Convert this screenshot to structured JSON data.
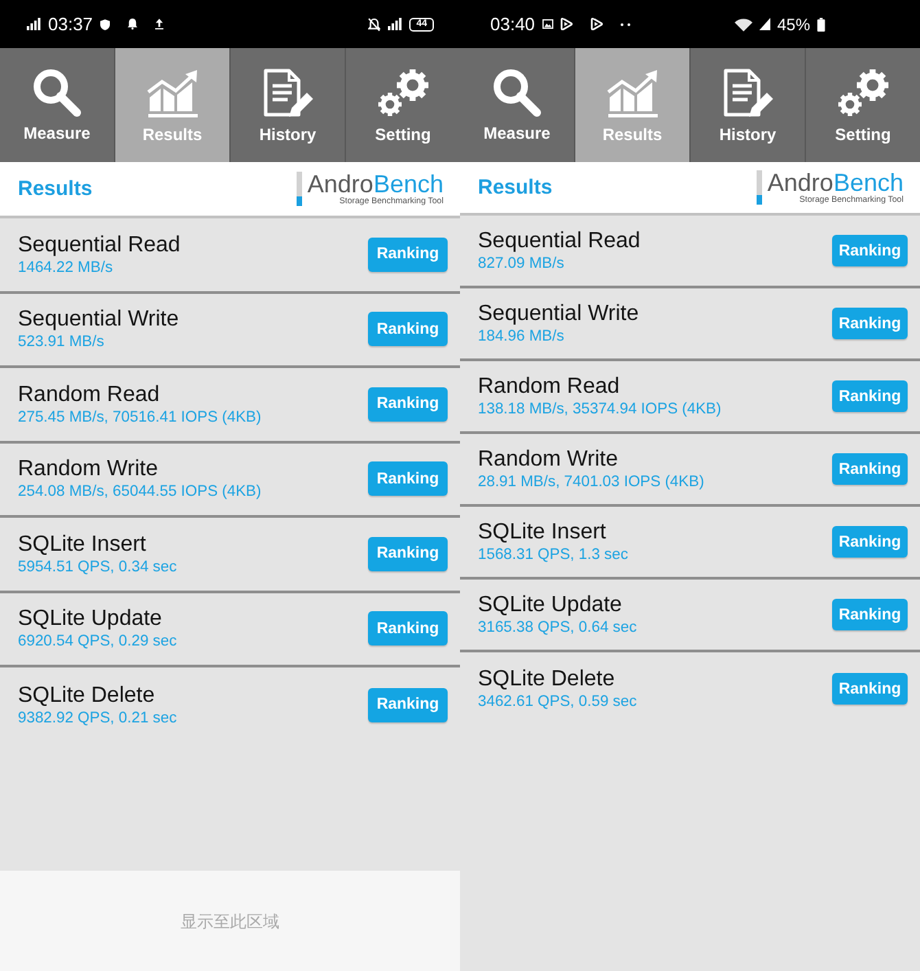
{
  "screens": [
    {
      "status_bar": {
        "time": "03:37",
        "battery": {
          "kind": "inside",
          "text": "44"
        }
      },
      "tabs": [
        {
          "label": "Measure",
          "selected": false
        },
        {
          "label": "Results",
          "selected": true
        },
        {
          "label": "History",
          "selected": false
        },
        {
          "label": "Setting",
          "selected": false
        }
      ],
      "header": {
        "title": "Results",
        "logo": {
          "wordmark": [
            "Andro",
            "Bench"
          ],
          "tagline": "Storage Benchmarking Tool"
        }
      },
      "results": [
        {
          "name": "Sequential Read",
          "value": "1464.22 MB/s",
          "button": "Ranking"
        },
        {
          "name": "Sequential Write",
          "value": "523.91 MB/s",
          "button": "Ranking"
        },
        {
          "name": "Random Read",
          "value": "275.45 MB/s, 70516.41 IOPS (4KB)",
          "button": "Ranking"
        },
        {
          "name": "Random Write",
          "value": "254.08 MB/s, 65044.55 IOPS (4KB)",
          "button": "Ranking"
        },
        {
          "name": "SQLite Insert",
          "value": "5954.51 QPS, 0.34 sec",
          "button": "Ranking"
        },
        {
          "name": "SQLite Update",
          "value": "6920.54 QPS, 0.29 sec",
          "button": "Ranking"
        },
        {
          "name": "SQLite Delete",
          "value": "9382.92 QPS, 0.21 sec",
          "button": "Ranking"
        }
      ],
      "footer": {
        "text": "显示至此区域"
      }
    },
    {
      "status_bar": {
        "time": "03:40",
        "battery": {
          "kind": "beside",
          "text": "45%"
        }
      },
      "tabs": [
        {
          "label": "Measure",
          "selected": false
        },
        {
          "label": "Results",
          "selected": true
        },
        {
          "label": "History",
          "selected": false
        },
        {
          "label": "Setting",
          "selected": false
        }
      ],
      "header": {
        "title": "Results",
        "logo": {
          "wordmark": [
            "Andro",
            "Bench"
          ],
          "tagline": "Storage Benchmarking Tool"
        }
      },
      "results": [
        {
          "name": "Sequential Read",
          "value": "827.09 MB/s",
          "button": "Ranking"
        },
        {
          "name": "Sequential Write",
          "value": "184.96 MB/s",
          "button": "Ranking"
        },
        {
          "name": "Random Read",
          "value": "138.18 MB/s, 35374.94 IOPS (4KB)",
          "button": "Ranking"
        },
        {
          "name": "Random Write",
          "value": "28.91 MB/s, 7401.03 IOPS (4KB)",
          "button": "Ranking"
        },
        {
          "name": "SQLite Insert",
          "value": "1568.31 QPS, 1.3 sec",
          "button": "Ranking"
        },
        {
          "name": "SQLite Update",
          "value": "3165.38 QPS, 0.64 sec",
          "button": "Ranking"
        },
        {
          "name": "SQLite Delete",
          "value": "3462.61 QPS, 0.59 sec",
          "button": "Ranking"
        }
      ]
    }
  ]
}
